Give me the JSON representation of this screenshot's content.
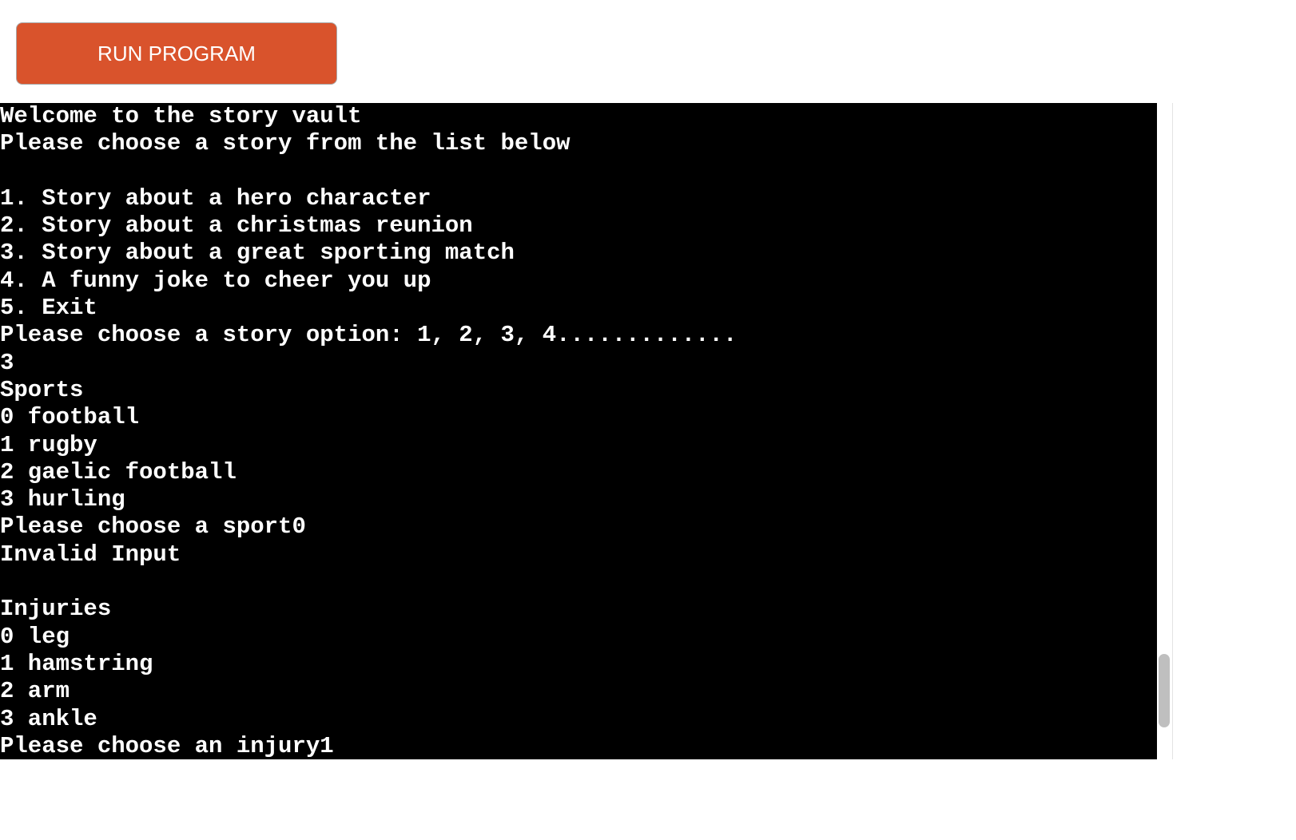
{
  "toolbar": {
    "run_label": "RUN PROGRAM"
  },
  "terminal": {
    "lines": [
      "Welcome to the story vault",
      "Please choose a story from the list below",
      "",
      "1. Story about a hero character",
      "2. Story about a christmas reunion",
      "3. Story about a great sporting match",
      "4. A funny joke to cheer you up",
      "5. Exit",
      "Please choose a story option: 1, 2, 3, 4.............",
      "3",
      "Sports",
      "0 football",
      "1 rugby",
      "2 gaelic football",
      "3 hurling",
      "Please choose a sport0",
      "Invalid Input",
      "",
      "Injuries",
      "0 leg",
      "1 hamstring",
      "2 arm",
      "3 ankle",
      "Please choose an injury1"
    ]
  },
  "colors": {
    "run_button": "#d9532c",
    "terminal_bg": "#000000",
    "terminal_fg": "#ffffff"
  }
}
